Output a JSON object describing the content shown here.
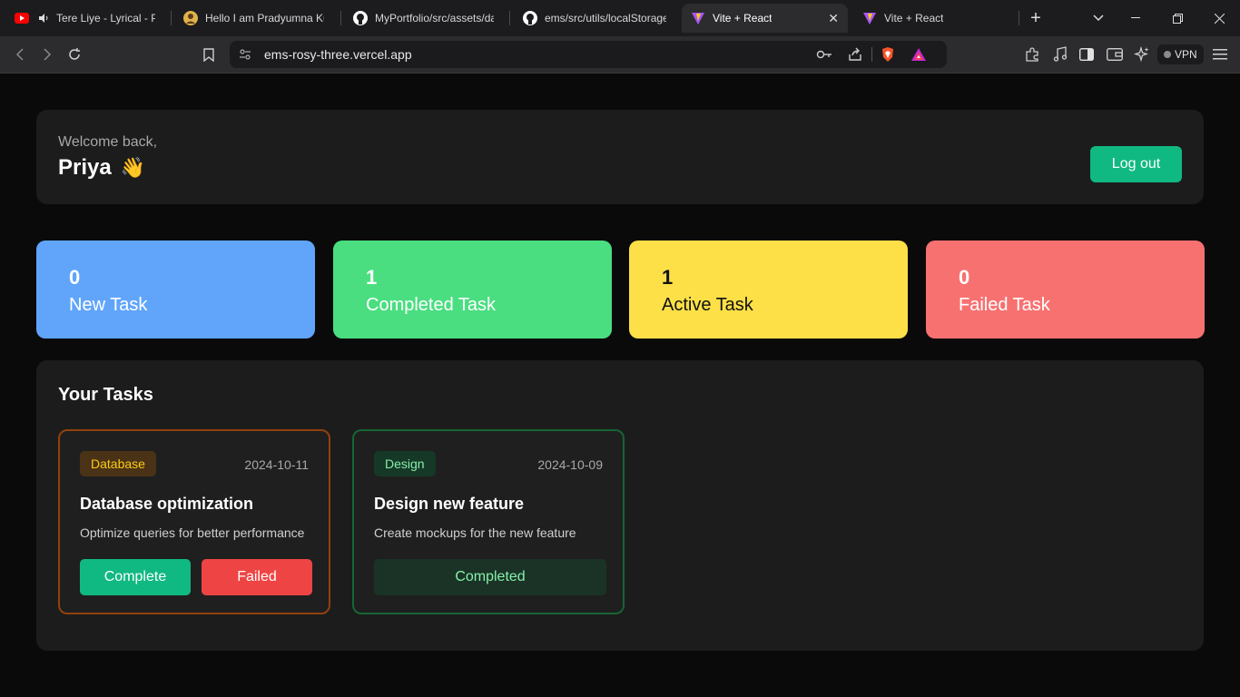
{
  "browser": {
    "tabs": [
      {
        "title": "Tere Liye - Lyrical - Prin",
        "icon": "youtube-icon"
      },
      {
        "title": "Hello I am Pradyumna Ku",
        "icon": "avatar-icon"
      },
      {
        "title": "MyPortfolio/src/assets/dat",
        "icon": "github-icon"
      },
      {
        "title": "ems/src/utils/localStorage",
        "icon": "github-icon"
      },
      {
        "title": "Vite + React",
        "icon": "vite-icon"
      },
      {
        "title": "Vite + React",
        "icon": "vite-icon"
      }
    ],
    "url": "ems-rosy-three.vercel.app",
    "vpn_label": "VPN"
  },
  "header": {
    "welcome": "Welcome back,",
    "name": "Priya",
    "wave": "👋",
    "logout_label": "Log out"
  },
  "stats": [
    {
      "count": "0",
      "label": "New Task",
      "color": "#60a5fa",
      "text_color": "#ffffff"
    },
    {
      "count": "1",
      "label": "Completed Task",
      "color": "#4ade80",
      "text_color": "#ffffff"
    },
    {
      "count": "1",
      "label": "Active Task",
      "color": "#fde047",
      "text_color": "#111111"
    },
    {
      "count": "0",
      "label": "Failed Task",
      "color": "#f87171",
      "text_color": "#ffffff"
    }
  ],
  "tasks": {
    "title": "Your Tasks",
    "items": [
      {
        "category": "Database",
        "date": "2024-10-11",
        "title": "Database optimization",
        "description": "Optimize queries for better performance",
        "complete_label": "Complete",
        "failed_label": "Failed",
        "border_color": "#92400e"
      },
      {
        "category": "Design",
        "date": "2024-10-09",
        "title": "Design new feature",
        "description": "Create mockups for the new feature",
        "status_label": "Completed",
        "border_color": "#166534"
      }
    ]
  }
}
